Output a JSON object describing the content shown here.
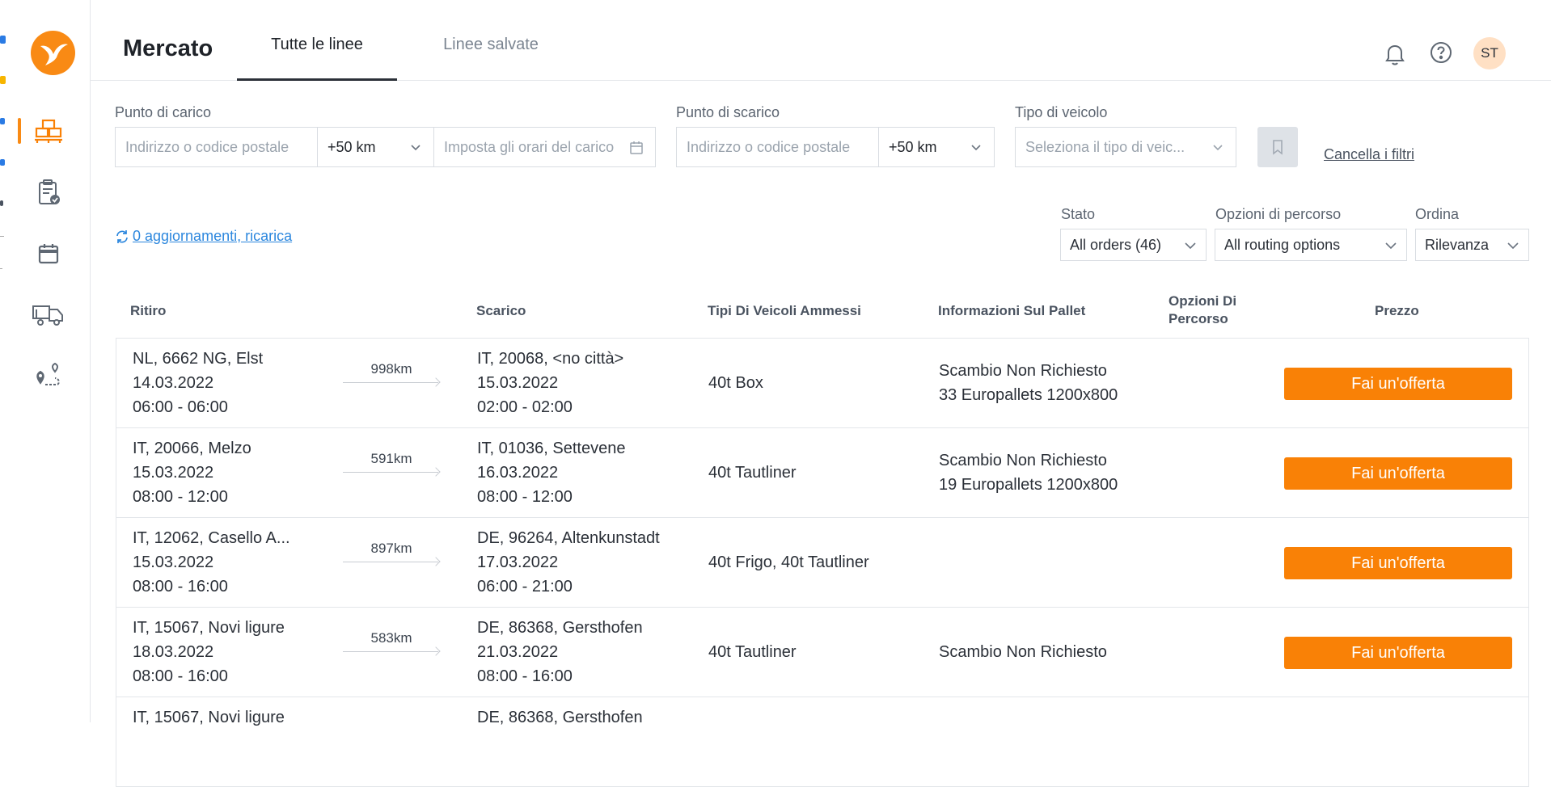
{
  "header": {
    "title": "Mercato",
    "tabs": [
      {
        "label": "Tutte le linee",
        "active": true
      },
      {
        "label": "Linee salvate",
        "active": false
      }
    ],
    "avatar_initials": "ST"
  },
  "filters": {
    "pickup": {
      "label": "Punto di carico",
      "address_placeholder": "Indirizzo o codice postale",
      "radius": "+50 km",
      "time_placeholder": "Imposta gli orari del carico"
    },
    "delivery": {
      "label": "Punto di scarico",
      "address_placeholder": "Indirizzo o codice postale",
      "radius": "+50 km"
    },
    "vehicle": {
      "label": "Tipo di veicolo",
      "placeholder": "Seleziona il tipo di veic..."
    },
    "clear_label": "Cancella i filtri"
  },
  "reload_link": "0 aggiornamenti, ricarica",
  "selectors": {
    "stato": {
      "label": "Stato",
      "value": "All orders (46)"
    },
    "routing": {
      "label": "Opzioni di percorso",
      "value": "All routing options"
    },
    "sort": {
      "label": "Ordina",
      "value": "Rilevanza"
    }
  },
  "table": {
    "headers": {
      "pickup": "Ritiro",
      "delivery": "Scarico",
      "vehicles": "Tipi Di Veicoli Ammessi",
      "pallet": "Informazioni Sul Pallet",
      "routing": "Opzioni Di Percorso",
      "price": "Prezzo"
    },
    "offer_label": "Fai un'offerta",
    "rows": [
      {
        "pickup_place": "NL, 6662 NG, Elst",
        "pickup_date": "14.03.2022",
        "pickup_time": "06:00 - 06:00",
        "distance": "998km",
        "delivery_place": "IT, 20068, <no città>",
        "delivery_date": "15.03.2022",
        "delivery_time": "02:00 - 02:00",
        "vehicles": "40t Box",
        "pallet_exchange": "Scambio Non Richiesto",
        "pallet_count": "33 Europallets 1200x800"
      },
      {
        "pickup_place": "IT, 20066, Melzo",
        "pickup_date": "15.03.2022",
        "pickup_time": "08:00 - 12:00",
        "distance": "591km",
        "delivery_place": "IT, 01036, Settevene",
        "delivery_date": "16.03.2022",
        "delivery_time": "08:00 - 12:00",
        "vehicles": "40t Tautliner",
        "pallet_exchange": "Scambio Non Richiesto",
        "pallet_count": "19 Europallets 1200x800"
      },
      {
        "pickup_place": "IT, 12062, Casello A...",
        "pickup_date": "15.03.2022",
        "pickup_time": "08:00 - 16:00",
        "distance": "897km",
        "delivery_place": "DE, 96264, Altenkunstadt",
        "delivery_date": "17.03.2022",
        "delivery_time": "06:00 - 21:00",
        "vehicles": "40t Frigo, 40t Tautliner",
        "pallet_exchange": "",
        "pallet_count": ""
      },
      {
        "pickup_place": "IT, 15067, Novi ligure",
        "pickup_date": "18.03.2022",
        "pickup_time": "08:00 - 16:00",
        "distance": "583km",
        "delivery_place": "DE, 86368, Gersthofen",
        "delivery_date": "21.03.2022",
        "delivery_time": "08:00 - 16:00",
        "vehicles": "40t Tautliner",
        "pallet_exchange": "Scambio Non Richiesto",
        "pallet_count": ""
      },
      {
        "pickup_place": "IT, 15067, Novi ligure",
        "pickup_date": "",
        "pickup_time": "",
        "distance": "",
        "delivery_place": "DE, 86368, Gersthofen",
        "delivery_date": "",
        "delivery_time": "",
        "vehicles": "",
        "pallet_exchange": "",
        "pallet_count": ""
      }
    ]
  },
  "colors": {
    "accent": "#f98106",
    "link": "#2c87de"
  }
}
